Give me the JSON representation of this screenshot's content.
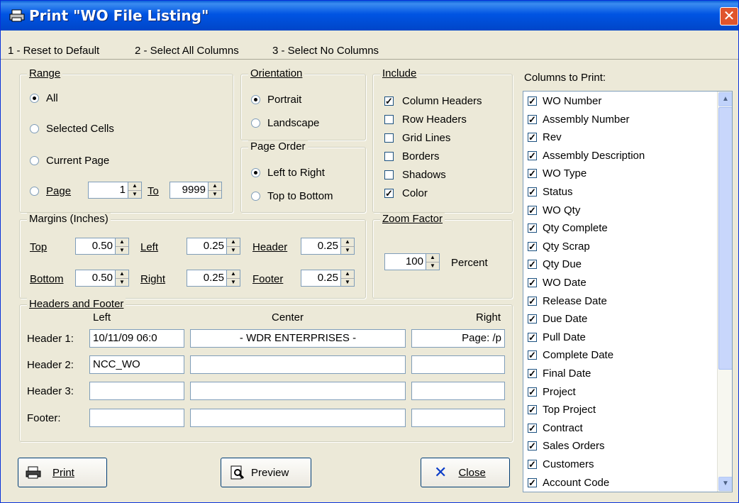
{
  "window": {
    "title": "Print \"WO File Listing\"",
    "close_glyph": "✕"
  },
  "menu": [
    "1 - Reset to Default",
    "2 - Select All Columns",
    "3 - Select No Columns"
  ],
  "range": {
    "label": "Range",
    "all": "All",
    "selected": "Selected Cells",
    "current": "Current Page",
    "page": "Page",
    "page_from": "1",
    "to": "To",
    "page_to": "9999",
    "selected_option": "All"
  },
  "orientation": {
    "label": "Orientation",
    "portrait": "Portrait",
    "landscape": "Landscape",
    "selected_option": "Portrait"
  },
  "page_order": {
    "label": "Page Order",
    "ltr": "Left to Right",
    "ttb": "Top to Bottom",
    "selected_option": "Left to Right"
  },
  "include": {
    "label": "Include",
    "items": [
      {
        "label": "Column Headers",
        "checked": true
      },
      {
        "label": "Row Headers",
        "checked": false
      },
      {
        "label": "Grid Lines",
        "checked": false
      },
      {
        "label": "Borders",
        "checked": false
      },
      {
        "label": "Shadows",
        "checked": false
      },
      {
        "label": "Color",
        "checked": true
      }
    ]
  },
  "margins": {
    "label": "Margins (Inches)",
    "top_label": "Top",
    "top": "0.50",
    "left_label": "Left",
    "left": "0.25",
    "header_label": "Header",
    "header": "0.25",
    "bottom_label": "Bottom",
    "bottom": "0.50",
    "right_label": "Right",
    "right": "0.25",
    "footer_label": "Footer",
    "footer": "0.25"
  },
  "zoom": {
    "label": "Zoom Factor",
    "value": "100",
    "unit": "Percent"
  },
  "headers_footer": {
    "label": "Headers and Footer",
    "col_left": "Left",
    "col_center": "Center",
    "col_right": "Right",
    "rows": [
      {
        "label": "Header 1:",
        "left": "10/11/09  06:0",
        "center": "-   WDR ENTERPRISES   -",
        "right": "Page: /p"
      },
      {
        "label": "Header 2:",
        "left": "NCC_WO",
        "center": "",
        "right": ""
      },
      {
        "label": "Header 3:",
        "left": "",
        "center": "",
        "right": ""
      },
      {
        "label": "Footer:",
        "left": "",
        "center": "",
        "right": ""
      }
    ]
  },
  "columns": {
    "label": "Columns to Print:",
    "items": [
      "WO Number",
      "Assembly Number",
      "Rev",
      "Assembly Description",
      "WO Type",
      "Status",
      "WO Qty",
      "Qty Complete",
      "Qty Scrap",
      "Qty Due",
      "WO Date",
      "Release Date",
      "Due Date",
      "Pull Date",
      "Complete Date",
      "Final Date",
      "Project",
      "Top Project",
      "Contract",
      "Sales Orders",
      "Customers",
      "Account Code"
    ],
    "all_checked": true
  },
  "buttons": {
    "print": "Print",
    "preview": "Preview",
    "close": "Close"
  },
  "colors": {
    "title_bar": "#0054e3",
    "dialog_bg": "#ece9d8",
    "close_x": "#0a3cc8"
  }
}
